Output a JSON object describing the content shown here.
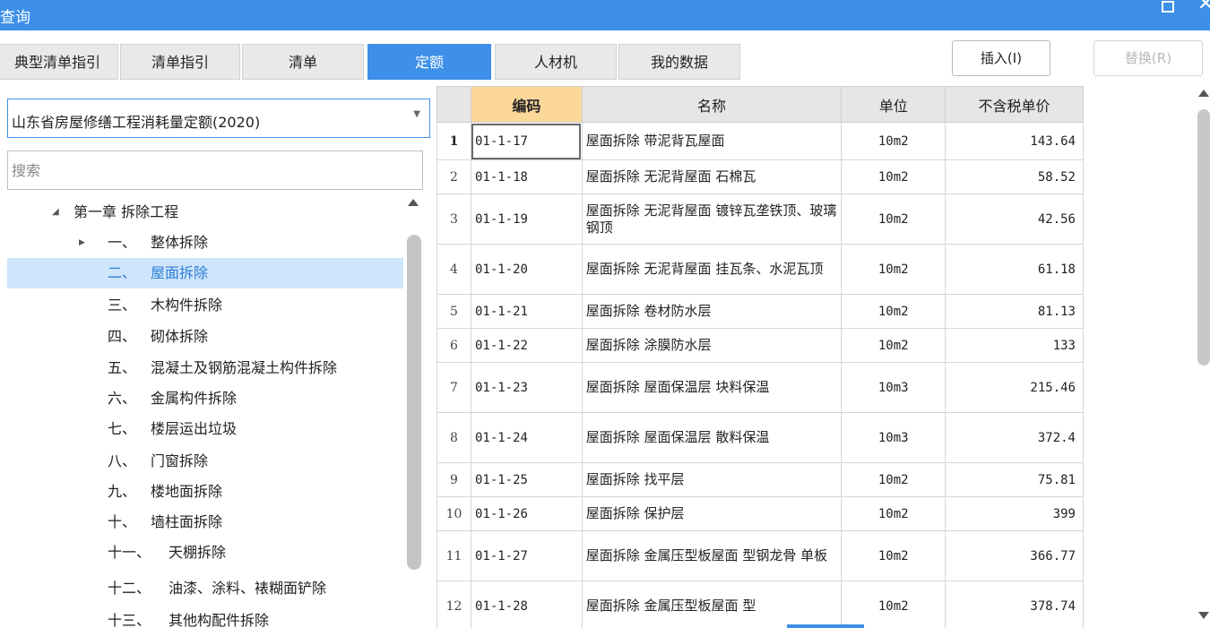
{
  "window": {
    "title": "查询",
    "restore_icon": "restore-icon",
    "close_icon": "close-icon",
    "close_glyph": "✕"
  },
  "tabs": [
    {
      "label": "典型清单指引",
      "active": false
    },
    {
      "label": "清单指引",
      "active": false
    },
    {
      "label": "清单",
      "active": false
    },
    {
      "label": "定额",
      "active": true
    },
    {
      "label": "人材机",
      "active": false
    },
    {
      "label": "我的数据",
      "active": false
    }
  ],
  "actions": {
    "insert_label": "插入(I)",
    "replace_label": "替换(R)",
    "replace_disabled": true
  },
  "left_panel": {
    "dataset_value": "山东省房屋修缮工程消耗量定额(2020)",
    "dataset_arrow_icon": "chevron-down-icon",
    "search_placeholder": "搜索",
    "tree": {
      "chapter": {
        "label": "第一章 拆除工程",
        "expanded": true
      },
      "sections": [
        {
          "num": "一、",
          "label": "整体拆除",
          "expandable": true,
          "selected": false
        },
        {
          "num": "二、",
          "label": "屋面拆除",
          "expandable": false,
          "selected": true
        },
        {
          "num": "三、",
          "label": "木构件拆除",
          "expandable": false,
          "selected": false
        },
        {
          "num": "四、",
          "label": "砌体拆除",
          "expandable": false,
          "selected": false
        },
        {
          "num": "五、",
          "label": "混凝土及钢筋混凝土构件拆除",
          "expandable": false,
          "selected": false
        },
        {
          "num": "六、",
          "label": "金属构件拆除",
          "expandable": false,
          "selected": false
        },
        {
          "num": "七、",
          "label": "楼层运出垃圾",
          "expandable": false,
          "selected": false
        },
        {
          "num": "八、",
          "label": "门窗拆除",
          "expandable": false,
          "selected": false
        },
        {
          "num": "九、",
          "label": "楼地面拆除",
          "expandable": false,
          "selected": false
        },
        {
          "num": "十、",
          "label": "墙柱面拆除",
          "expandable": false,
          "selected": false
        },
        {
          "num": "十一、",
          "label": "天棚拆除",
          "expandable": false,
          "selected": false
        },
        {
          "num": "十二、",
          "label": "油漆、涂料、裱糊面铲除",
          "expandable": false,
          "selected": false
        },
        {
          "num": "十三、",
          "label": "其他构配件拆除",
          "expandable": false,
          "selected": false
        }
      ]
    }
  },
  "grid": {
    "columns": [
      "编码",
      "名称",
      "单位",
      "不含税单价"
    ],
    "current_row": 1,
    "rows": [
      {
        "idx": "1",
        "code": "01-1-17",
        "name": "屋面拆除 带泥背瓦屋面",
        "unit": "10m2",
        "price": "143.64"
      },
      {
        "idx": "2",
        "code": "01-1-18",
        "name": "屋面拆除 无泥背屋面 石棉瓦",
        "unit": "10m2",
        "price": "58.52"
      },
      {
        "idx": "3",
        "code": "01-1-19",
        "name": "屋面拆除 无泥背屋面 镀锌瓦垄铁顶、玻璃钢顶",
        "unit": "10m2",
        "price": "42.56"
      },
      {
        "idx": "4",
        "code": "01-1-20",
        "name": "屋面拆除 无泥背屋面 挂瓦条、水泥瓦顶",
        "unit": "10m2",
        "price": "61.18"
      },
      {
        "idx": "5",
        "code": "01-1-21",
        "name": "屋面拆除 卷材防水层",
        "unit": "10m2",
        "price": "81.13"
      },
      {
        "idx": "6",
        "code": "01-1-22",
        "name": "屋面拆除 涂膜防水层",
        "unit": "10m2",
        "price": "133"
      },
      {
        "idx": "7",
        "code": "01-1-23",
        "name": "屋面拆除 屋面保温层 块料保温",
        "unit": "10m3",
        "price": "215.46"
      },
      {
        "idx": "8",
        "code": "01-1-24",
        "name": "屋面拆除 屋面保温层 散料保温",
        "unit": "10m3",
        "price": "372.4"
      },
      {
        "idx": "9",
        "code": "01-1-25",
        "name": "屋面拆除 找平层",
        "unit": "10m2",
        "price": "75.81"
      },
      {
        "idx": "10",
        "code": "01-1-26",
        "name": "屋面拆除 保护层",
        "unit": "10m2",
        "price": "399"
      },
      {
        "idx": "11",
        "code": "01-1-27",
        "name": "屋面拆除 金属压型板屋面 型钢龙骨 单板",
        "unit": "10m2",
        "price": "366.77"
      },
      {
        "idx": "12",
        "code": "01-1-28",
        "name": "屋面拆除 金属压型板屋面 型",
        "unit": "10m2",
        "price": "378.74"
      }
    ]
  },
  "colors": {
    "accent": "#3d8fe8",
    "selected_row_bg": "#cfe5fb",
    "code_header_bg": "#fbd89a"
  }
}
